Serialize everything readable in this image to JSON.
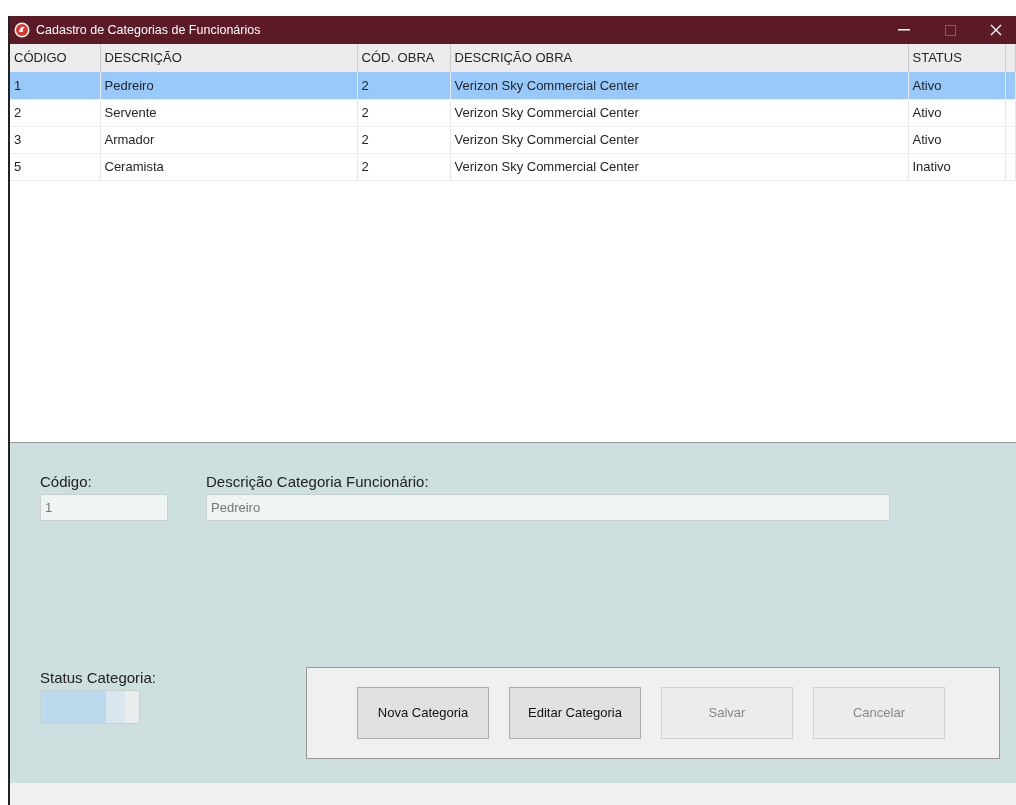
{
  "window": {
    "title": "Cadastro de Categorias de Funcionários"
  },
  "table": {
    "columns": [
      "CÓDIGO",
      "DESCRIÇÃO",
      "CÓD. OBRA",
      "DESCRIÇÃO OBRA",
      "STATUS"
    ],
    "rows": [
      {
        "cells": [
          "1",
          "Pedreiro",
          "2",
          "Verizon Sky Commercial Center",
          "Ativo"
        ],
        "selected": true
      },
      {
        "cells": [
          "2",
          "Servente",
          "2",
          "Verizon Sky Commercial Center",
          "Ativo"
        ],
        "selected": false
      },
      {
        "cells": [
          "3",
          "Armador",
          "2",
          "Verizon Sky Commercial Center",
          "Ativo"
        ],
        "selected": false
      },
      {
        "cells": [
          "5",
          "Ceramista",
          "2",
          "Verizon Sky Commercial Center",
          "Inativo"
        ],
        "selected": false
      }
    ]
  },
  "form": {
    "code_label": "Código:",
    "code_value": "1",
    "description_label": "Descrição Categoria Funcionário:",
    "description_value": "Pedreiro",
    "status_label": "Status Categoria:",
    "status_on": true
  },
  "buttons": [
    {
      "label": "Nova Categoria",
      "disabled": false
    },
    {
      "label": "Editar Categoria",
      "disabled": false
    },
    {
      "label": "Salvar",
      "disabled": true
    },
    {
      "label": "Cancelar",
      "disabled": true
    }
  ]
}
